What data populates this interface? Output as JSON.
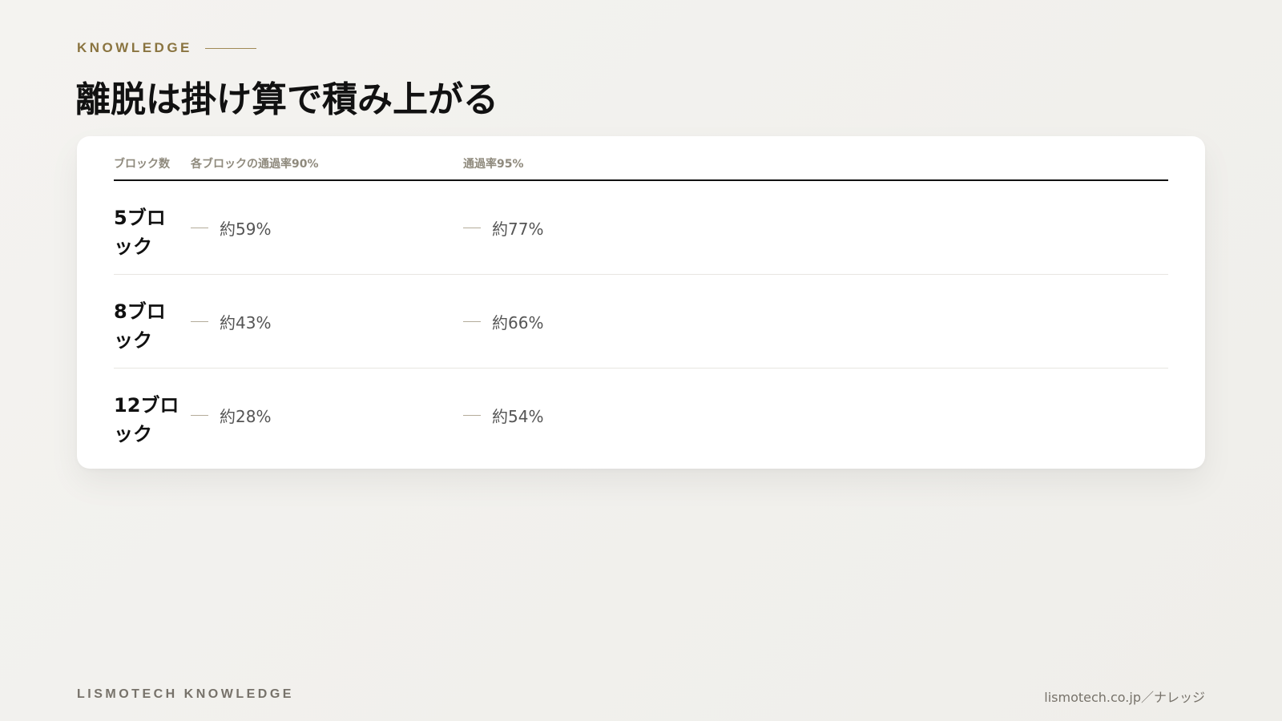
{
  "header": {
    "eyebrow": "KNOWLEDGE",
    "title": "離脱は掛け算で積み上がる"
  },
  "table": {
    "columns": [
      "ブロック数",
      "各ブロックの通過率90%",
      "通過率95%"
    ],
    "rows": [
      {
        "label": "5ブロック",
        "rate90": "約59%",
        "rate95": "約77%"
      },
      {
        "label": "8ブロック",
        "rate90": "約43%",
        "rate95": "約66%"
      },
      {
        "label": "12ブロック",
        "rate90": "約28%",
        "rate95": "約54%"
      }
    ]
  },
  "footer": {
    "brand": "LISMOTECH KNOWLEDGE",
    "url": "lismotech.co.jp／ナレッジ"
  },
  "colors": {
    "accent": "#8a7440",
    "background": "#f2f1ed",
    "card": "#ffffff",
    "muted": "#8f8a7d"
  }
}
